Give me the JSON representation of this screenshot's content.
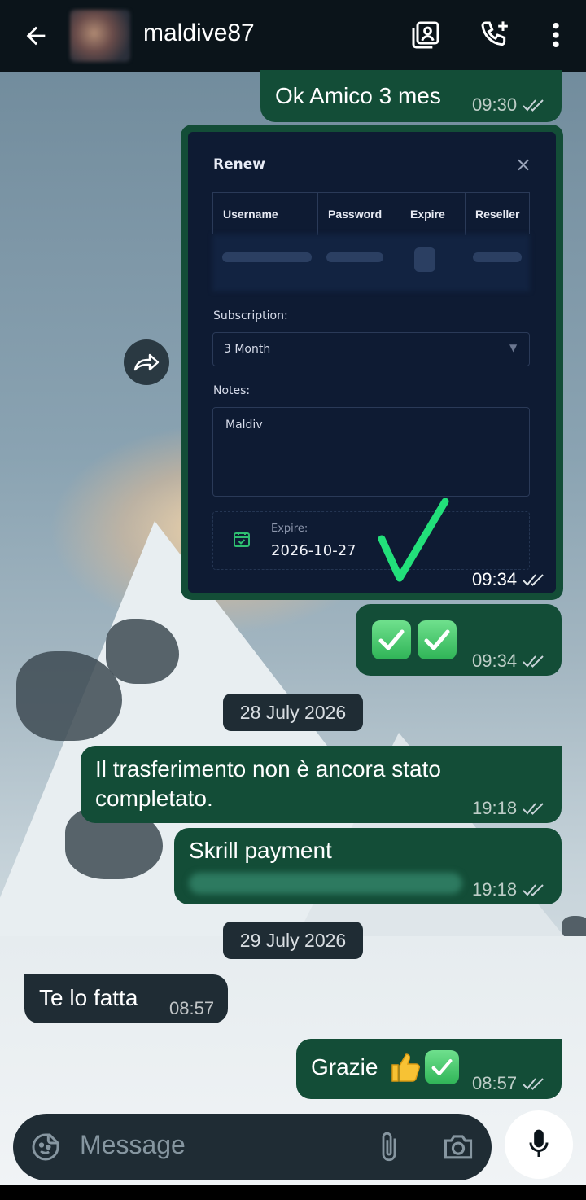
{
  "header": {
    "contact_name": "maldive87",
    "icons": [
      "back-arrow-icon",
      "contact-avatar",
      "media-icon",
      "add-call-icon",
      "more-vert-icon"
    ]
  },
  "messages": [
    {
      "direction": "out",
      "text": "Ok Amico  3 mes",
      "time": "09:30",
      "status": "read"
    },
    {
      "direction": "out",
      "type": "image",
      "time": "09:34",
      "status": "read",
      "image": {
        "title": "Renew",
        "columns": [
          "Username",
          "Password",
          "Expire",
          "Reseller"
        ],
        "subscription_label": "Subscription:",
        "subscription_value": "3 Month",
        "notes_label": "Notes:",
        "notes_value": "Maldiv",
        "expire_label": "Expire:",
        "expire_value": "2026-10-27"
      }
    },
    {
      "direction": "out",
      "type": "emoji",
      "emoji": "✅✅",
      "time": "09:34",
      "status": "read"
    },
    {
      "type": "date",
      "text": "28 July 2026"
    },
    {
      "direction": "out",
      "text": "Il trasferimento non è ancora stato completato.",
      "line1": "Il trasferimento non è ancora stato",
      "line2": "completato.",
      "time": "19:18",
      "status": "read"
    },
    {
      "direction": "out",
      "text": "Skrill payment",
      "time": "19:18",
      "status": "read"
    },
    {
      "type": "date",
      "text": "29 July 2026"
    },
    {
      "direction": "in",
      "text": "Te lo fatta",
      "time": "08:57"
    },
    {
      "direction": "out",
      "text": "Grazie",
      "emoji": "👍✅",
      "time": "08:57",
      "status": "read"
    }
  ],
  "composer": {
    "placeholder": "Message"
  },
  "colors": {
    "header": "#0b141a",
    "outgoing": "#134d37",
    "incoming": "#1f2c34",
    "accent": "#25d366"
  }
}
